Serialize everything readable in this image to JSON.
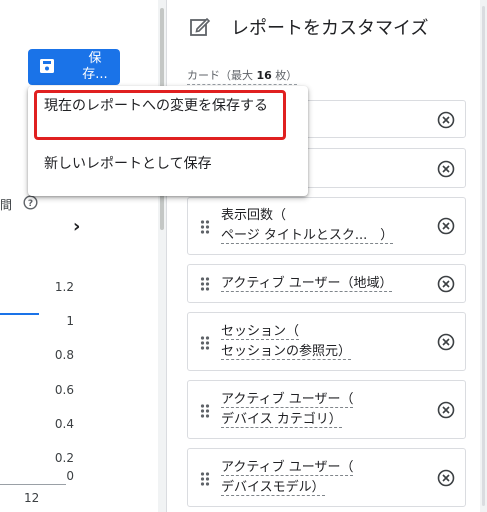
{
  "left": {
    "save_button_label": "保\n存...",
    "save_line1": "保",
    "save_line2": "存...",
    "time_label": "間",
    "y_ticks": [
      "1.2",
      "1",
      "0.8",
      "0.6",
      "0.4",
      "0.2",
      "0"
    ],
    "x_tick": "12"
  },
  "menu": {
    "item_save_changes": "現在のレポートへの変更を保存する",
    "item_save_new": "新しいレポートとして保存"
  },
  "panel": {
    "title": "レポートをカスタマイズ",
    "cards_label_prefix": "カード（最大 ",
    "cards_label_max": "16",
    "cards_label_suffix": " 枚）",
    "cards": [
      {
        "line1": "表示回数（",
        "line2": "ページ タイトルとスク...　）"
      },
      {
        "line1": "アクティブ ユーザー（地域）",
        "line2": ""
      },
      {
        "line1": "セッション（",
        "line2": "セッションの参照元）"
      },
      {
        "line1": "アクティブ ユーザー（",
        "line2": "デバイス カテゴリ）"
      },
      {
        "line1": "アクティブ ユーザー（",
        "line2": "デバイスモデル）"
      }
    ]
  },
  "colors": {
    "accent": "#1a73e8",
    "highlight": "#e02020"
  }
}
